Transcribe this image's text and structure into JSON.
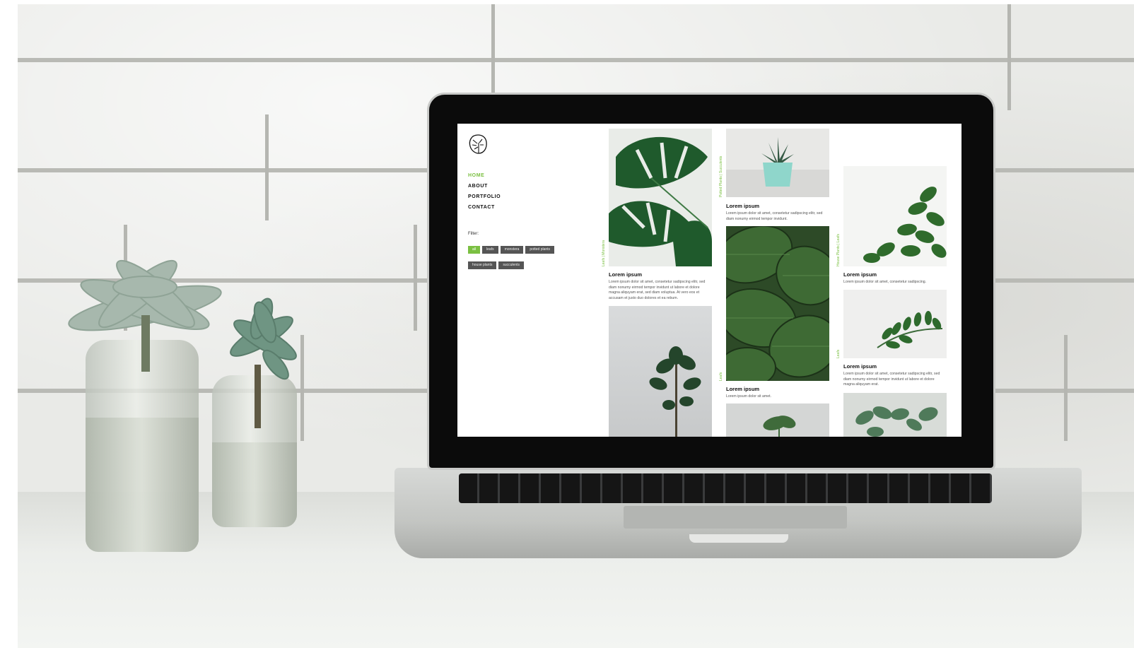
{
  "site": {
    "nav": [
      {
        "label": "HOME",
        "active": true
      },
      {
        "label": "ABOUT",
        "active": false
      },
      {
        "label": "PORTFOLIO",
        "active": false
      },
      {
        "label": "CONTACT",
        "active": false
      }
    ],
    "filter_label": "Filter:",
    "filters": [
      {
        "label": "all",
        "active": true
      },
      {
        "label": "leafs",
        "active": false
      },
      {
        "label": "monstera",
        "active": false
      },
      {
        "label": "potted plants",
        "active": false
      },
      {
        "label": "house plants",
        "active": false
      },
      {
        "label": "succulents",
        "active": false
      }
    ],
    "cards": [
      {
        "category": "Leafs | Monstera",
        "title": "Lorem ipsum",
        "text": "Lorem ipsum dolor sit amet, consetetur sadipscing elitr, sed diam nonumy eirmod tempor invidunt ut labore et dolore magna aliquyam erat, sed diam voluptua. At vero eos et accusam et justo duo dolores et ea rebum."
      },
      {
        "category": "",
        "title": "",
        "text": ""
      },
      {
        "category": "Potted Plants | Succulents",
        "title": "Lorem ipsum",
        "text": "Lorem ipsum dolor sit amet, consetetur sadipscing elitr, sed diam nonumy eirmod tempor invidunt."
      },
      {
        "category": "Leafs",
        "title": "Lorem ipsum",
        "text": "Lorem ipsum dolor sit amet."
      },
      {
        "category": "",
        "title": "",
        "text": ""
      },
      {
        "category": "House Plants | Leafs",
        "title": "Lorem ipsum",
        "text": "Lorem ipsum dolor sit amet, consetetur sadipscing."
      },
      {
        "category": "Leafs",
        "title": "Lorem ipsum",
        "text": "Lorem ipsum dolor sit amet, consetetur sadipscing elitr, sed diam nonumy eirmod tempor invidunt ut labore et dolore magna aliquyam erat."
      },
      {
        "category": "",
        "title": "",
        "text": ""
      }
    ]
  },
  "colors": {
    "accent": "#7bc042",
    "chip": "#555555",
    "bezel": "#0b0b0b"
  }
}
